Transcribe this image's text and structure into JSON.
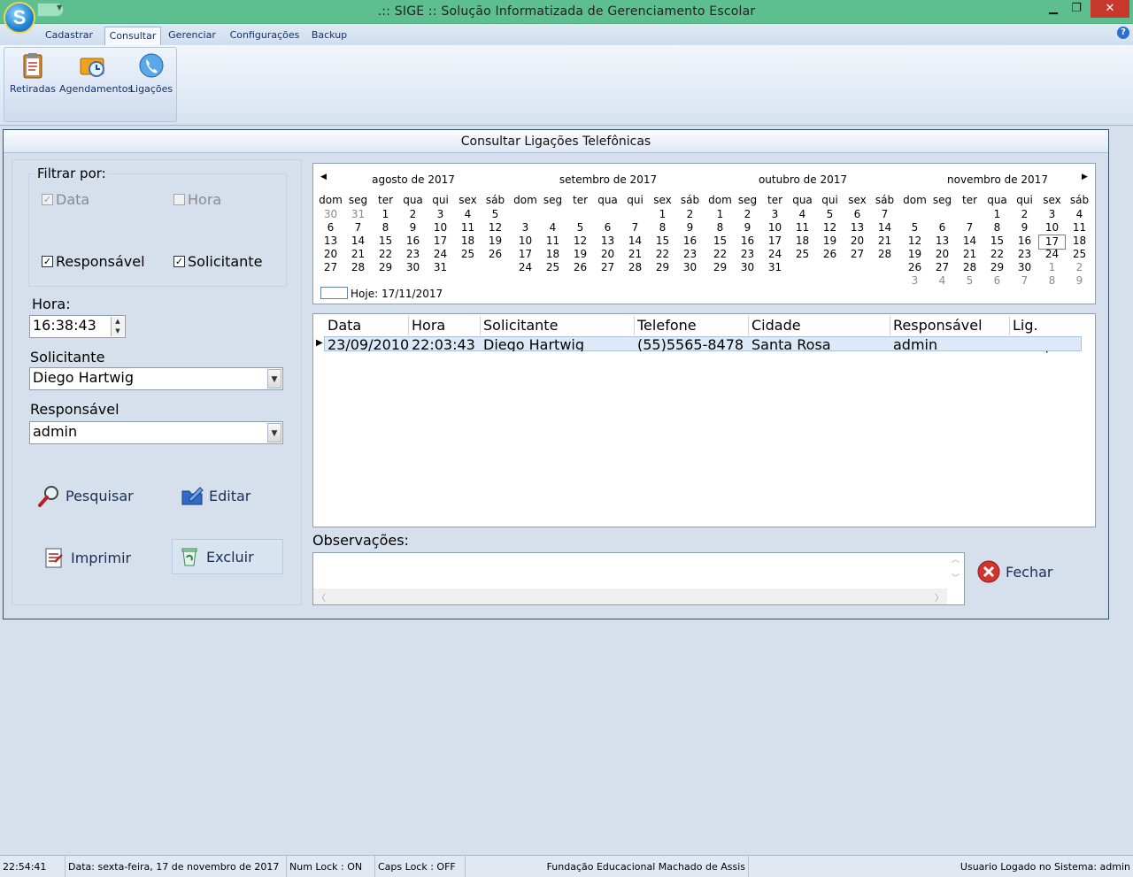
{
  "window": {
    "title": ".:: SIGE :: Solução Informatizada de Gerenciamento Escolar",
    "app_letter": "S",
    "minimize": "▁",
    "maximize": "❐",
    "close": "✕"
  },
  "ribbon": {
    "tabs": [
      {
        "label": "Cadastrar"
      },
      {
        "label": "Consultar"
      },
      {
        "label": "Gerenciar"
      },
      {
        "label": "Configurações"
      },
      {
        "label": "Backup"
      }
    ],
    "active_tab": "Consultar",
    "help": "?",
    "buttons": [
      {
        "label": "Retiradas",
        "icon": "clipboard-icon"
      },
      {
        "label": "Agendamentos",
        "icon": "calendar-clock-icon"
      },
      {
        "label": "Ligações",
        "icon": "phone-icon"
      }
    ]
  },
  "panel": {
    "title": "Consultar Ligações Telefônicas"
  },
  "filter": {
    "legend": "Filtrar por:",
    "data": {
      "label": "Data",
      "checked": true,
      "enabled": false
    },
    "hora": {
      "label": "Hora",
      "checked": false,
      "enabled": false
    },
    "responsavel": {
      "label": "Responsável",
      "checked": true
    },
    "solicitante": {
      "label": "Solicitante",
      "checked": true
    }
  },
  "form": {
    "hora_label": "Hora:",
    "hora_value": "16:38:43",
    "solicitante_label": "Solicitante",
    "solicitante_value": "Diego Hartwig",
    "responsavel_label": "Responsável",
    "responsavel_value": "admin"
  },
  "actions": {
    "pesquisar": "Pesquisar",
    "editar": "Editar",
    "imprimir": "Imprimir",
    "excluir": "Excluir",
    "fechar": "Fechar"
  },
  "calendar": {
    "weekdays": [
      "dom",
      "seg",
      "ter",
      "qua",
      "qui",
      "sex",
      "sáb"
    ],
    "months": [
      {
        "title": "agosto de 2017",
        "rows": [
          [
            "30",
            "31",
            "1",
            "2",
            "3",
            "4",
            "5"
          ],
          [
            "6",
            "7",
            "8",
            "9",
            "10",
            "11",
            "12"
          ],
          [
            "13",
            "14",
            "15",
            "16",
            "17",
            "18",
            "19"
          ],
          [
            "20",
            "21",
            "22",
            "23",
            "24",
            "25",
            "26"
          ],
          [
            "27",
            "28",
            "29",
            "30",
            "31",
            "",
            ""
          ]
        ],
        "dim": [
          [
            0,
            0
          ],
          [
            0,
            1
          ]
        ]
      },
      {
        "title": "setembro de 2017",
        "rows": [
          [
            "",
            "",
            "",
            "",
            "",
            "1",
            "2"
          ],
          [
            "3",
            "4",
            "5",
            "6",
            "7",
            "8",
            "9"
          ],
          [
            "10",
            "11",
            "12",
            "13",
            "14",
            "15",
            "16"
          ],
          [
            "17",
            "18",
            "19",
            "20",
            "21",
            "22",
            "23"
          ],
          [
            "24",
            "25",
            "26",
            "27",
            "28",
            "29",
            "30"
          ]
        ],
        "dim": []
      },
      {
        "title": "outubro de 2017",
        "rows": [
          [
            "1",
            "2",
            "3",
            "4",
            "5",
            "6",
            "7"
          ],
          [
            "8",
            "9",
            "10",
            "11",
            "12",
            "13",
            "14"
          ],
          [
            "15",
            "16",
            "17",
            "18",
            "19",
            "20",
            "21"
          ],
          [
            "22",
            "23",
            "24",
            "25",
            "26",
            "27",
            "28"
          ],
          [
            "29",
            "30",
            "31",
            "",
            "",
            "",
            ""
          ]
        ],
        "dim": []
      },
      {
        "title": "novembro de 2017",
        "rows": [
          [
            "",
            "",
            "",
            "1",
            "2",
            "3",
            "4"
          ],
          [
            "5",
            "6",
            "7",
            "8",
            "9",
            "10",
            "11"
          ],
          [
            "12",
            "13",
            "14",
            "15",
            "16",
            "17",
            "18"
          ],
          [
            "19",
            "20",
            "21",
            "22",
            "23",
            "24",
            "25"
          ],
          [
            "26",
            "27",
            "28",
            "29",
            "30",
            "1",
            "2"
          ],
          [
            "3",
            "4",
            "5",
            "6",
            "7",
            "8",
            "9"
          ]
        ],
        "dim": [
          [
            4,
            5
          ],
          [
            4,
            6
          ],
          [
            5,
            0
          ],
          [
            5,
            1
          ],
          [
            5,
            2
          ],
          [
            5,
            3
          ],
          [
            5,
            4
          ],
          [
            5,
            5
          ],
          [
            5,
            6
          ]
        ],
        "today": [
          2,
          5
        ]
      }
    ],
    "today_label": "Hoje: 17/11/2017"
  },
  "grid": {
    "columns": [
      "Data",
      "Hora",
      "Solicitante",
      "Telefone",
      "Cidade",
      "Responsável",
      "Lig. Comp."
    ],
    "rows": [
      [
        "23/09/2010",
        "22:03:43",
        "Diego Hartwig",
        "(55)5565-8478",
        "Santa Rosa",
        "admin",
        ""
      ]
    ]
  },
  "observacoes": {
    "label": "Observações:",
    "value": ""
  },
  "statusbar": {
    "time": "22:54:41",
    "date": "Data: sexta-feira, 17 de novembro de 2017",
    "num_lock": "Num Lock : ON",
    "caps_lock": "Caps Lock : OFF",
    "org": "Fundação Educacional Machado de Assis",
    "user": "Usuario Logado no Sistema: admin"
  }
}
